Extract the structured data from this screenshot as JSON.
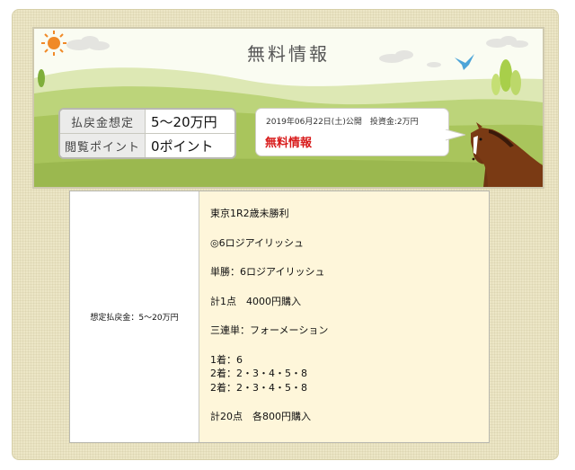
{
  "banner": {
    "title": "無料情報",
    "info": [
      {
        "label": "払戻金想定",
        "value": "5〜20万円"
      },
      {
        "label": "閲覧ポイント",
        "value": "0ポイント"
      }
    ],
    "post": {
      "date_line": "2019年06月22日(土)公開　投資金:2万円",
      "title": "無料情報"
    }
  },
  "content": {
    "left_label": "想定払戻金：5〜20万円",
    "race": "東京1R2歳未勝利",
    "honmei": "◎6ロジアイリッシュ",
    "tansho": "単勝：6ロジアイリッシュ",
    "tansho_total": "計1点　4000円購入",
    "sanrentan": "三連単：フォーメーション",
    "formation": [
      "1着：6",
      "2着：2・3・4・5・8",
      "2着：2・3・4・5・8"
    ],
    "sanrentan_total": "計20点　各800円購入"
  },
  "colors": {
    "background": "#ece6c6",
    "grass": "#a9c55c",
    "accent_red": "#d81b1b",
    "content_bg": "#fef6da",
    "bird": "#4ca4d8",
    "horse": "#7a3a14"
  }
}
